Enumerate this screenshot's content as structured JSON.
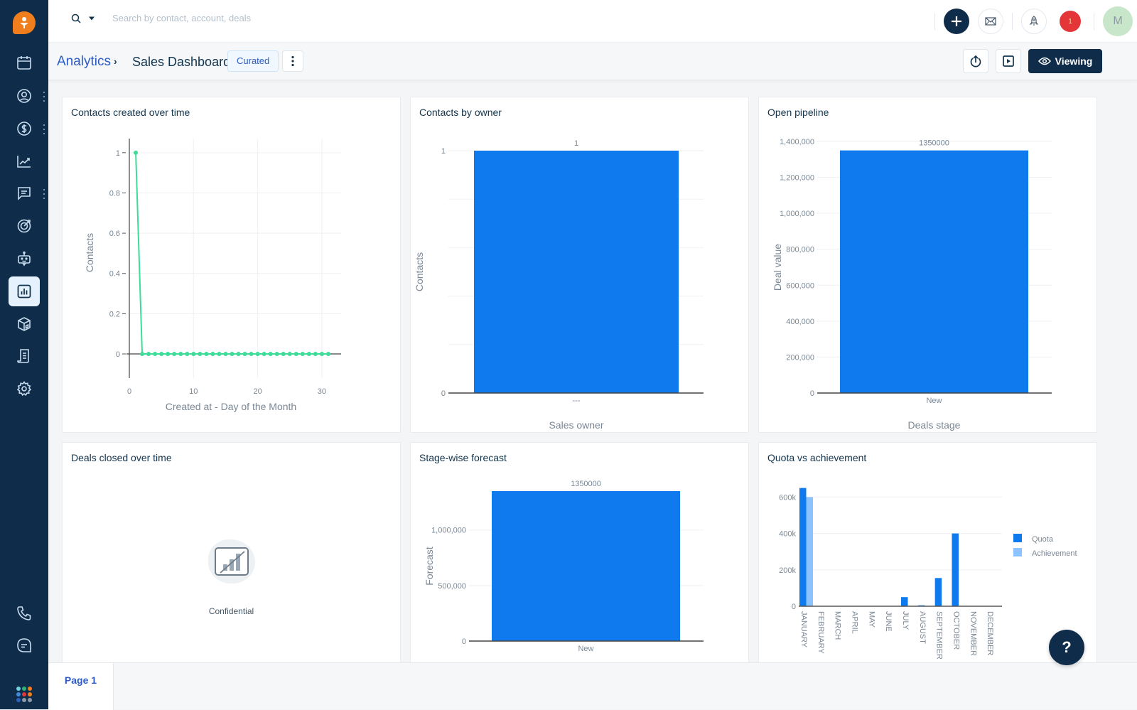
{
  "colors": {
    "sidebar_bg": "#0f2d4a",
    "brand_orange": "#f07e1c",
    "link_blue": "#2c5cc5",
    "bar_blue": "#0f7aed",
    "bar_light_blue": "#8cc2ff",
    "line_green": "#3ddc97",
    "notification_red": "#e43538",
    "avatar_green": "#c8e6c9"
  },
  "sidebar": {
    "items": [
      {
        "icon": "calendar-icon",
        "label": "Calendar"
      },
      {
        "icon": "contacts-icon",
        "label": "Contacts"
      },
      {
        "icon": "deals-icon",
        "label": "Deals"
      },
      {
        "icon": "reports-icon",
        "label": "Reports"
      },
      {
        "icon": "conversations-icon",
        "label": "Conversations"
      },
      {
        "icon": "target-icon",
        "label": "Goals"
      },
      {
        "icon": "bot-icon",
        "label": "Bots"
      },
      {
        "icon": "analytics-icon",
        "label": "Analytics",
        "active": true
      },
      {
        "icon": "products-icon",
        "label": "Products"
      },
      {
        "icon": "documents-icon",
        "label": "Documents"
      },
      {
        "icon": "settings-icon",
        "label": "Settings"
      }
    ],
    "bottom": [
      {
        "icon": "phone-icon",
        "label": "Phone"
      },
      {
        "icon": "chat-icon",
        "label": "Chat"
      },
      {
        "icon": "apps-grid-icon",
        "label": "Apps"
      }
    ]
  },
  "topbar": {
    "search_placeholder": "Search by contact, account, deals",
    "notification_count": "1",
    "avatar_initial": "M"
  },
  "header": {
    "breadcrumb_root": "Analytics",
    "breadcrumb_separator": "›",
    "title": "Sales Dashboard",
    "badge": "Curated",
    "viewing_label": "Viewing"
  },
  "widgets": {
    "contacts_over_time": {
      "title": "Contacts created over time"
    },
    "contacts_by_owner": {
      "title": "Contacts by owner"
    },
    "open_pipeline": {
      "title": "Open pipeline"
    },
    "deals_closed": {
      "title": "Deals closed over time",
      "message": "Confidential"
    },
    "stage_forecast": {
      "title": "Stage-wise forecast"
    },
    "quota_achievement": {
      "title": "Quota vs achievement"
    }
  },
  "chart_data": [
    {
      "id": "contacts_over_time",
      "type": "line",
      "title": "Contacts created over time",
      "xlabel": "Created at - Day of the Month",
      "ylabel": "Contacts",
      "x": [
        1,
        2,
        3,
        4,
        5,
        6,
        7,
        8,
        9,
        10,
        11,
        12,
        13,
        14,
        15,
        16,
        17,
        18,
        19,
        20,
        21,
        22,
        23,
        24,
        25,
        26,
        27,
        28,
        29,
        30,
        31
      ],
      "values": [
        1,
        0,
        0,
        0,
        0,
        0,
        0,
        0,
        0,
        0,
        0,
        0,
        0,
        0,
        0,
        0,
        0,
        0,
        0,
        0,
        0,
        0,
        0,
        0,
        0,
        0,
        0,
        0,
        0,
        0,
        0
      ],
      "xticks": [
        0,
        10,
        20,
        30
      ],
      "yticks": [
        "0",
        "0.2",
        "0.4",
        "0.6",
        "0.8",
        "1"
      ],
      "xlim": [
        0,
        33
      ],
      "ylim": [
        -0.12,
        1.07
      ],
      "grid": true
    },
    {
      "id": "contacts_by_owner",
      "type": "bar",
      "title": "Contacts by owner",
      "xlabel": "Sales owner",
      "ylabel": "Contacts",
      "categories": [
        "---"
      ],
      "values": [
        1
      ],
      "data_labels": [
        "1"
      ],
      "yticks": [
        {
          "v": 0,
          "label": "0"
        },
        {
          "v": 1,
          "label": "1"
        }
      ],
      "gridlines": [
        0.2,
        0.4,
        0.6,
        0.8
      ],
      "ylim": [
        0,
        1
      ]
    },
    {
      "id": "open_pipeline",
      "type": "bar",
      "title": "Open pipeline",
      "xlabel": "Deals stage",
      "ylabel": "Deal value",
      "categories": [
        "New"
      ],
      "values": [
        1350000
      ],
      "data_labels": [
        "1350000"
      ],
      "yticks": [
        {
          "v": 0,
          "label": "0"
        },
        {
          "v": 200000,
          "label": "200,000"
        },
        {
          "v": 400000,
          "label": "400,000"
        },
        {
          "v": 600000,
          "label": "600,000"
        },
        {
          "v": 800000,
          "label": "800,000"
        },
        {
          "v": 1000000,
          "label": "1,000,000"
        },
        {
          "v": 1200000,
          "label": "1,200,000"
        },
        {
          "v": 1400000,
          "label": "1,400,000"
        }
      ],
      "ylim": [
        0,
        1400000
      ]
    },
    {
      "id": "stage_forecast",
      "type": "bar",
      "title": "Stage-wise forecast",
      "xlabel": "",
      "ylabel": "Forecast",
      "categories": [
        "New"
      ],
      "values": [
        1350000
      ],
      "data_labels": [
        "1350000"
      ],
      "yticks": [
        {
          "v": 0,
          "label": "0"
        },
        {
          "v": 500000,
          "label": "500,000"
        },
        {
          "v": 1000000,
          "label": "1,000,000"
        }
      ],
      "ylim": [
        0,
        1350000
      ]
    },
    {
      "id": "quota_achievement",
      "type": "bar",
      "title": "Quota vs achievement",
      "categories": [
        "JANUARY",
        "FEBRUARY",
        "MARCH",
        "APRIL",
        "MAY",
        "JUNE",
        "JULY",
        "AUGUST",
        "SEPTEMBER",
        "OCTOBER",
        "NOVEMBER",
        "DECEMBER"
      ],
      "series": [
        {
          "name": "Quota",
          "values": [
            650000,
            0,
            0,
            0,
            0,
            0,
            50000,
            5000,
            155000,
            400000,
            0,
            0
          ]
        },
        {
          "name": "Achievement",
          "values": [
            600000,
            0,
            0,
            0,
            0,
            0,
            0,
            0,
            0,
            0,
            0,
            0
          ]
        }
      ],
      "yticks": [
        {
          "v": 0,
          "label": "0"
        },
        {
          "v": 200000,
          "label": "200k"
        },
        {
          "v": 400000,
          "label": "400k"
        },
        {
          "v": 600000,
          "label": "600k"
        }
      ],
      "ylim": [
        0,
        650000
      ],
      "legend": "right"
    }
  ],
  "footer": {
    "page_tab": "Page 1",
    "help_label": "?"
  }
}
